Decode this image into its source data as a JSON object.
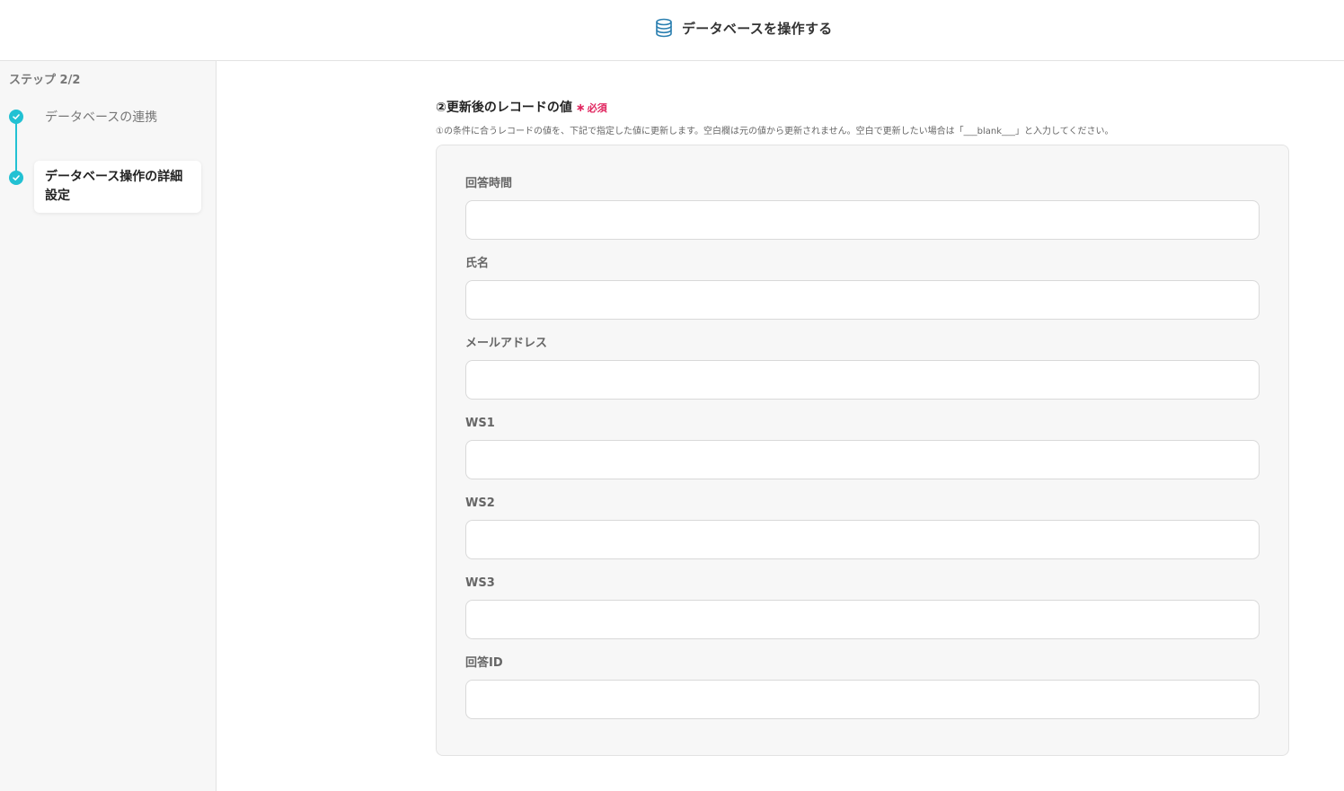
{
  "header": {
    "title": "データベースを操作する",
    "icon": "database-icon",
    "icon_color": "#2a7fb0"
  },
  "sidebar": {
    "step_counter": "ステップ 2/2",
    "steps": [
      {
        "label": "データベースの連携",
        "status": "complete"
      },
      {
        "label": "データベース操作の詳細設定",
        "status": "complete-current"
      }
    ],
    "accent_color": "#22c1d3"
  },
  "section": {
    "title": "②更新後のレコードの値",
    "required_label": "必須",
    "description": "①の条件に合うレコードの値を、下記で指定した値に更新します。空白欄は元の値から更新されません。空白で更新したい場合は「___blank___」と入力してください。"
  },
  "fields": [
    {
      "label": "回答時間",
      "value": ""
    },
    {
      "label": "氏名",
      "value": ""
    },
    {
      "label": "メールアドレス",
      "value": ""
    },
    {
      "label": "WS1",
      "value": ""
    },
    {
      "label": "WS2",
      "value": ""
    },
    {
      "label": "WS3",
      "value": ""
    },
    {
      "label": "回答ID",
      "value": ""
    }
  ]
}
